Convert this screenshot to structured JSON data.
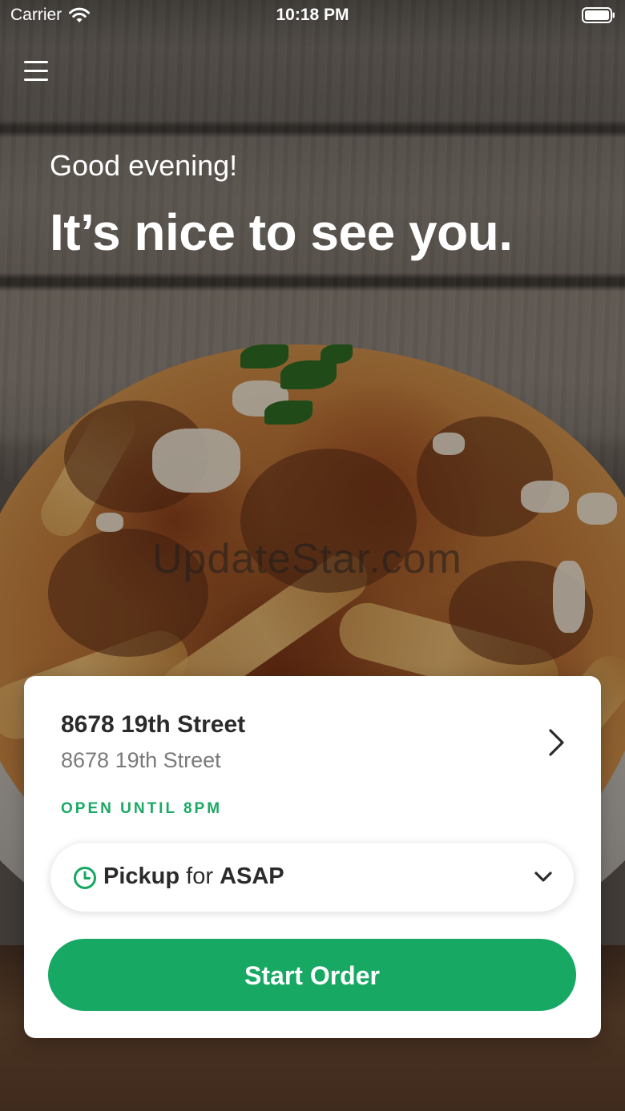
{
  "status_bar": {
    "carrier": "Carrier",
    "time": "10:18 PM",
    "wifi_icon": "wifi-icon",
    "battery_icon": "battery-icon"
  },
  "header": {
    "menu_icon": "hamburger-menu-icon",
    "greeting": "Good evening!",
    "headline": "It’s nice to see you."
  },
  "background": {
    "watermark": "UpdateStar.com",
    "description_colors": {
      "accent_green": "#17a863",
      "text_dark": "#2b2b2b",
      "text_muted": "#7a7a7a"
    }
  },
  "store_card": {
    "store_name": "8678 19th Street",
    "store_address": "8678 19th Street",
    "hours_status": "OPEN UNTIL 8PM",
    "order_mode": {
      "mode": "Pickup",
      "connector": "for",
      "time": "ASAP"
    },
    "start_order_label": "Start Order"
  }
}
